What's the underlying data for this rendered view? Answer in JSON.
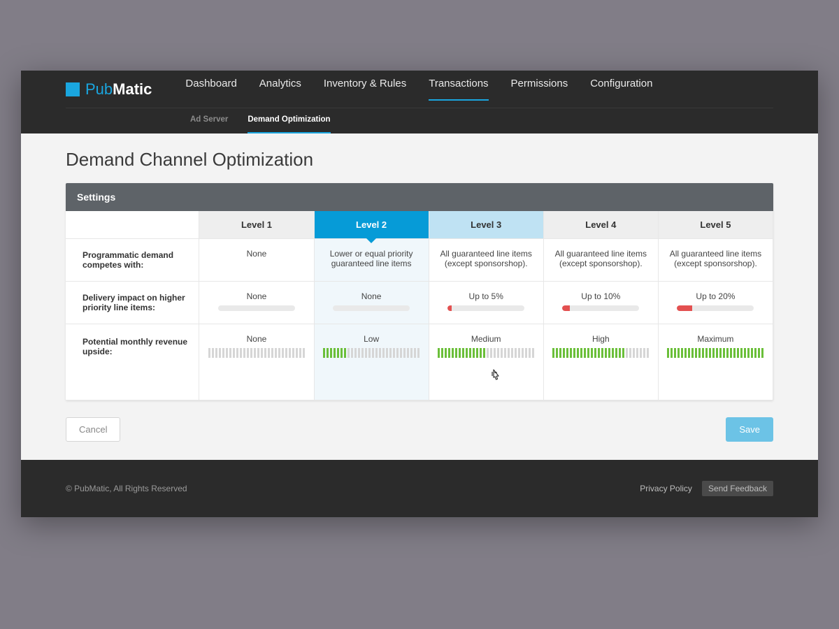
{
  "logo": {
    "brand1": "Pub",
    "brand2": "Matic"
  },
  "nav": {
    "items": [
      {
        "label": "Dashboard"
      },
      {
        "label": "Analytics"
      },
      {
        "label": "Inventory & Rules"
      },
      {
        "label": "Transactions",
        "active": true
      },
      {
        "label": "Permissions"
      },
      {
        "label": "Configuration"
      }
    ],
    "sub": [
      {
        "label": "Ad Server"
      },
      {
        "label": "Demand Optimization",
        "active": true
      }
    ]
  },
  "page": {
    "title": "Demand Channel Optimization"
  },
  "panel": {
    "header": "Settings"
  },
  "table": {
    "row_labels": [
      "Programmatic demand competes with:",
      "Delivery impact on higher priority line items:",
      "Potential monthly revenue upside:"
    ],
    "levels": [
      {
        "name": "Level 1",
        "compete": "None",
        "delivery": {
          "label": "None",
          "pct": 0
        },
        "revenue": {
          "label": "None",
          "ticks": 0
        }
      },
      {
        "name": "Level 2",
        "compete": "Lower or equal priority guaranteed line items",
        "delivery": {
          "label": "None",
          "pct": 0
        },
        "revenue": {
          "label": "Low",
          "ticks": 7
        },
        "selected": true
      },
      {
        "name": "Level 3",
        "compete": "All guaranteed line items (except sponsorshop).",
        "delivery": {
          "label": "Up to 5%",
          "pct": 5
        },
        "revenue": {
          "label": "Medium",
          "ticks": 14
        },
        "hover": true
      },
      {
        "name": "Level 4",
        "compete": "All guaranteed line items (except sponsorshop).",
        "delivery": {
          "label": "Up to 10%",
          "pct": 10
        },
        "revenue": {
          "label": "High",
          "ticks": 21
        }
      },
      {
        "name": "Level 5",
        "compete": "All guaranteed line items (except sponsorshop).",
        "delivery": {
          "label": "Up to 20%",
          "pct": 20
        },
        "revenue": {
          "label": "Maximum",
          "ticks": 28
        }
      }
    ],
    "tick_total": 28
  },
  "buttons": {
    "cancel": "Cancel",
    "save": "Save"
  },
  "footer": {
    "copyright": "© PubMatic, All Rights Reserved",
    "privacy": "Privacy Policy",
    "feedback": "Send Feedback"
  }
}
